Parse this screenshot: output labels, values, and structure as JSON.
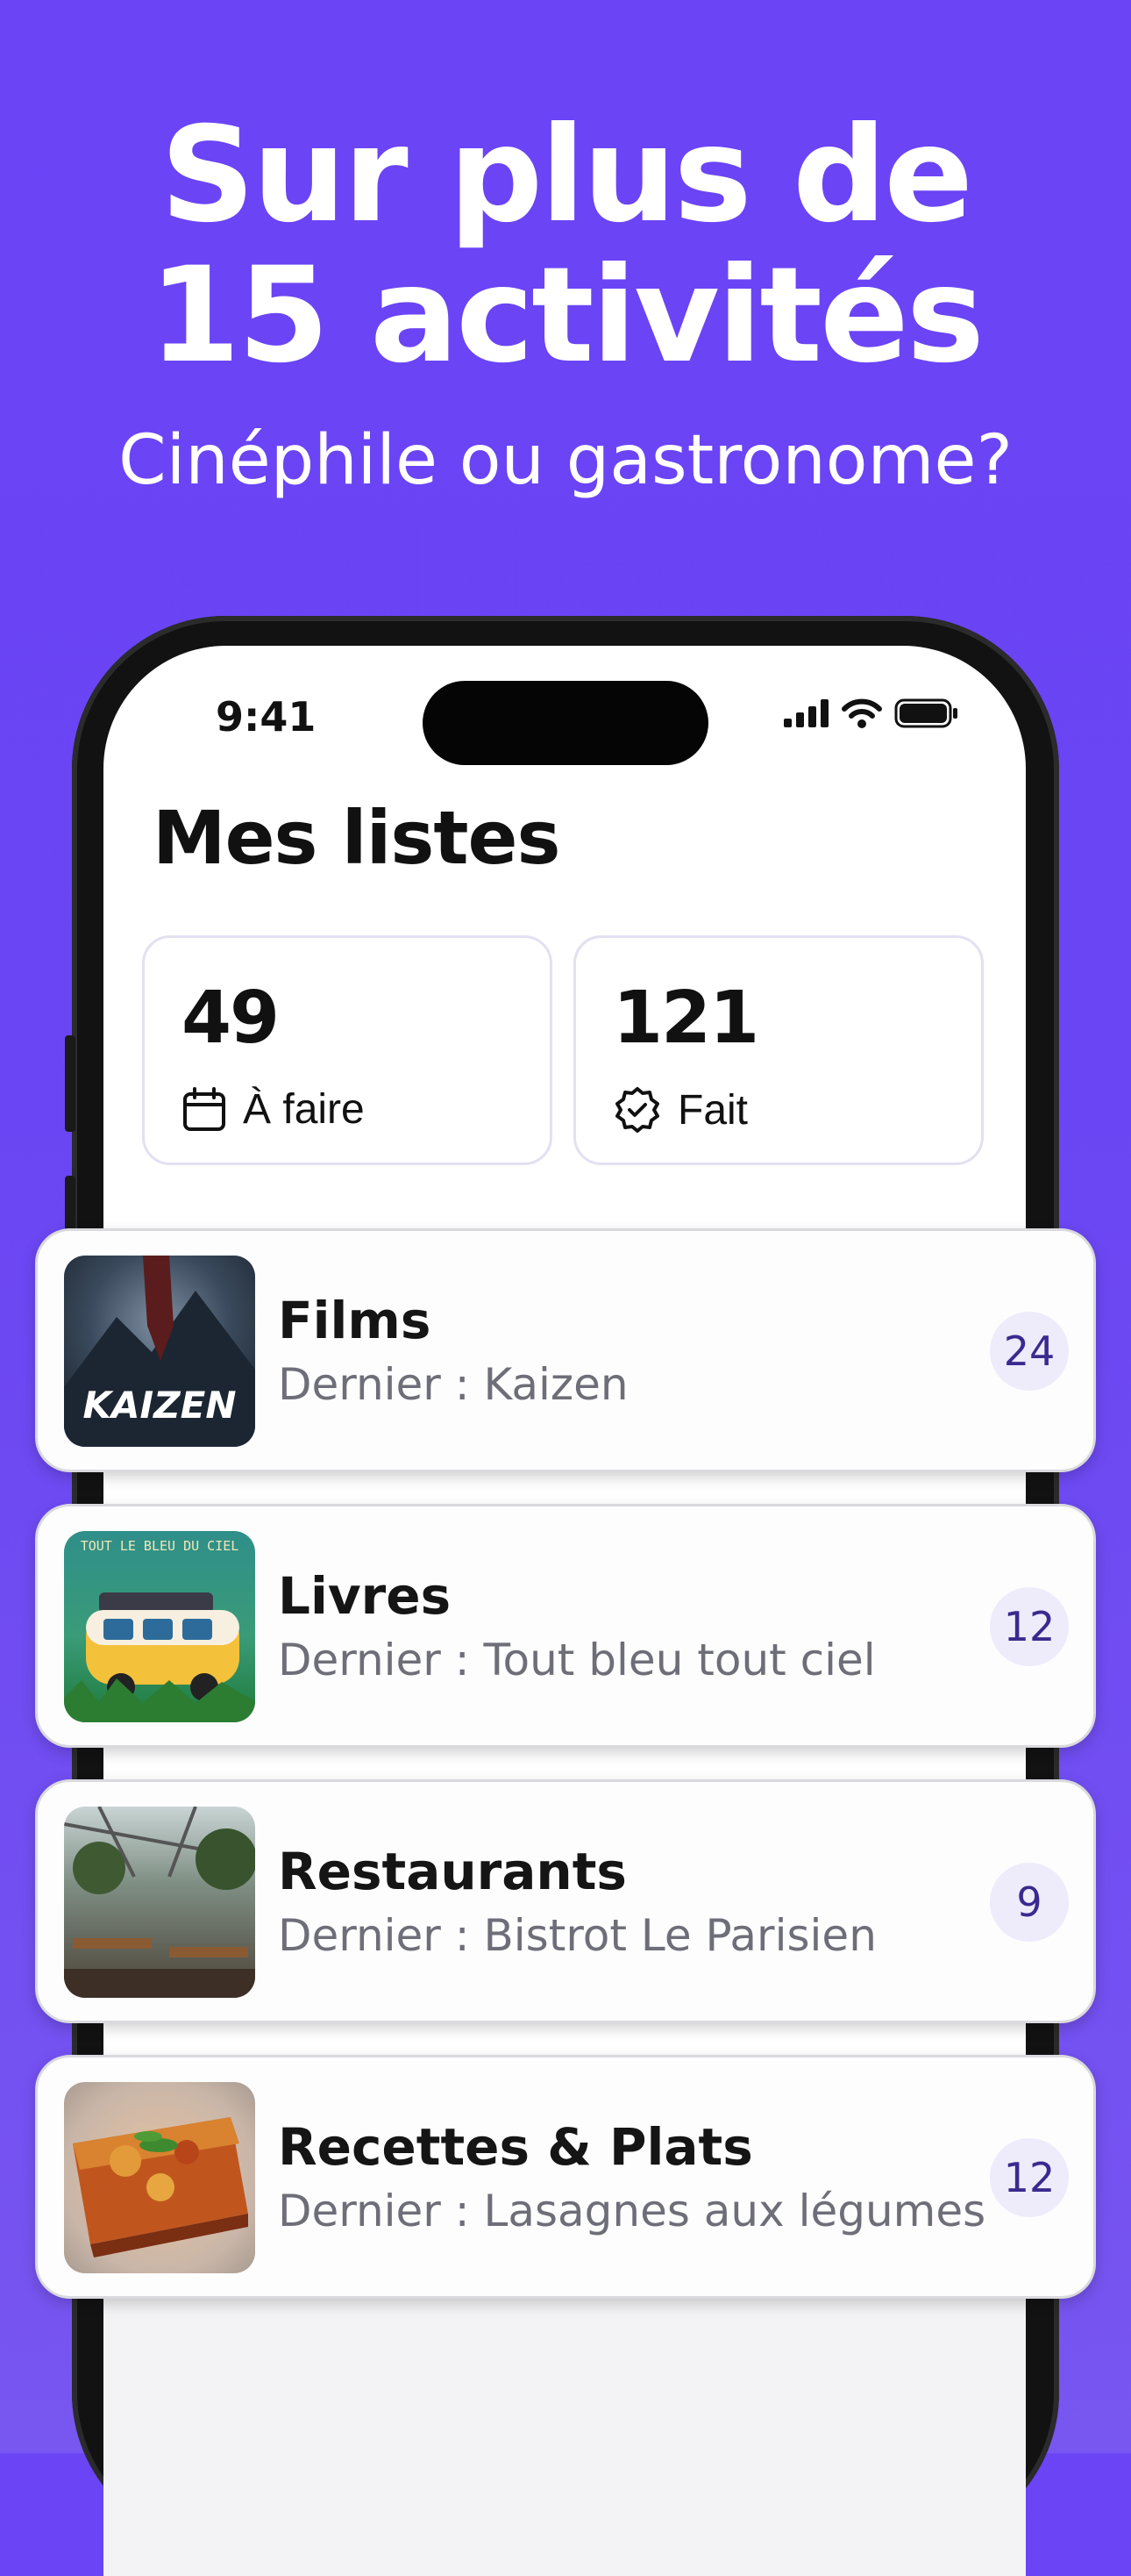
{
  "headline": {
    "line1": "Sur plus de",
    "line2": "15 activités"
  },
  "subheadline": "Cinéphile ou gastronome?",
  "status_bar": {
    "time": "9:41"
  },
  "screen_title": "Mes listes",
  "stats": [
    {
      "value": "49",
      "label": "À faire",
      "icon": "calendar-icon"
    },
    {
      "value": "121",
      "label": "Fait",
      "icon": "check-badge-icon"
    }
  ],
  "lists": [
    {
      "title": "Films",
      "subtitle": "Dernier : Kaizen",
      "count": "24",
      "thumb_caption": "KAIZEN"
    },
    {
      "title": "Livres",
      "subtitle": "Dernier : Tout bleu tout ciel",
      "count": "12",
      "thumb_caption": "TOUT LE BLEU DU CIEL"
    },
    {
      "title": "Restaurants",
      "subtitle": "Dernier : Bistrot Le Parisien",
      "count": "9"
    },
    {
      "title": "Recettes & Plats",
      "subtitle": "Dernier : Lasagnes aux légumes",
      "count": "12"
    }
  ],
  "colors": {
    "background": "#6b44f6",
    "badge_bg": "#eeebfb",
    "badge_text": "#3a2a8f"
  }
}
